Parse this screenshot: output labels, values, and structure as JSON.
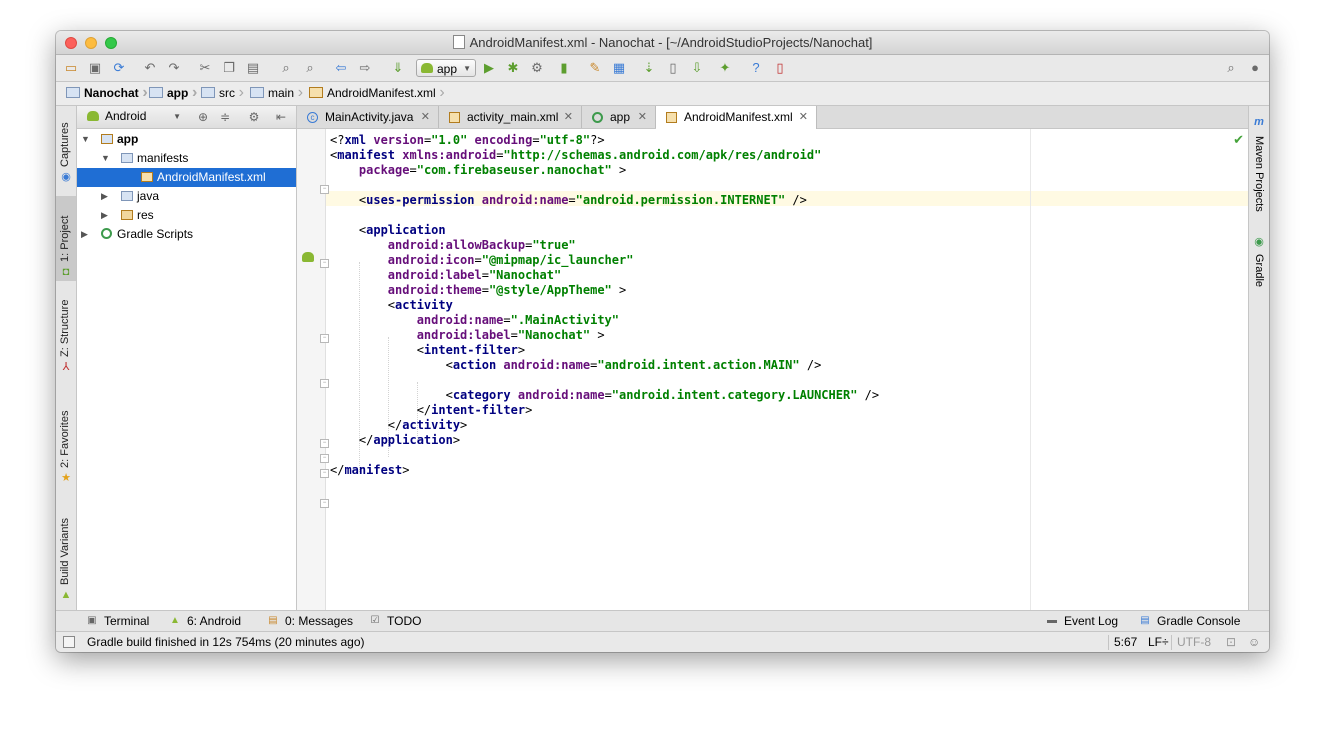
{
  "window": {
    "title": "AndroidManifest.xml - Nanochat - [~/AndroidStudioProjects/Nanochat]"
  },
  "toolbar": {
    "run_config": "app"
  },
  "breadcrumbs": [
    "Nanochat",
    "app",
    "src",
    "main",
    "AndroidManifest.xml"
  ],
  "left_tools": [
    {
      "label": "Captures"
    },
    {
      "label": "1: Project"
    },
    {
      "label": "Z: Structure"
    },
    {
      "label": "2: Favorites"
    },
    {
      "label": "Build Variants"
    }
  ],
  "right_tools": [
    {
      "label": "Maven Projects"
    },
    {
      "label": "Gradle"
    }
  ],
  "project": {
    "view": "Android",
    "tree": [
      {
        "label": "app",
        "icon": "app-folder-icon"
      },
      {
        "label": "manifests",
        "icon": "folder-icon"
      },
      {
        "label": "AndroidManifest.xml",
        "icon": "xml-file-icon",
        "selected": true
      },
      {
        "label": "java",
        "icon": "folder-icon"
      },
      {
        "label": "res",
        "icon": "res-folder-icon"
      },
      {
        "label": "Gradle Scripts",
        "icon": "gradle-icon"
      }
    ]
  },
  "tabs": [
    {
      "label": "MainActivity.java",
      "icon": "java-class-icon"
    },
    {
      "label": "activity_main.xml",
      "icon": "xml-file-icon"
    },
    {
      "label": "app",
      "icon": "gradle-icon"
    },
    {
      "label": "AndroidManifest.xml",
      "icon": "xml-file-icon",
      "active": true
    }
  ],
  "code_lines": [
    [
      [
        "pl",
        "<?"
      ],
      [
        "tg",
        "xml "
      ],
      [
        "an",
        "version"
      ],
      [
        "pl",
        "="
      ],
      [
        "av",
        "\"1.0\""
      ],
      [
        "pl",
        " "
      ],
      [
        "an",
        "encoding"
      ],
      [
        "pl",
        "="
      ],
      [
        "av",
        "\"utf-8\""
      ],
      [
        "pl",
        "?>"
      ]
    ],
    [
      [
        "pl",
        "<"
      ],
      [
        "tg",
        "manifest "
      ],
      [
        "an",
        "xmlns:android"
      ],
      [
        "pl",
        "="
      ],
      [
        "av",
        "\"http://schemas.android.com/apk/res/android\""
      ]
    ],
    [
      [
        "pl",
        "    "
      ],
      [
        "an",
        "package"
      ],
      [
        "pl",
        "="
      ],
      [
        "av",
        "\"com.firebaseuser.nanochat\""
      ],
      [
        "pl",
        " >"
      ]
    ],
    [],
    [
      [
        "pl",
        "    <"
      ],
      [
        "tg",
        "uses-permission "
      ],
      [
        "an",
        "android:name"
      ],
      [
        "pl",
        "="
      ],
      [
        "av",
        "\"android.permission.INTERNET\""
      ],
      [
        "pl",
        " />"
      ]
    ],
    [],
    [
      [
        "pl",
        "    <"
      ],
      [
        "tg",
        "application"
      ]
    ],
    [
      [
        "pl",
        "        "
      ],
      [
        "an",
        "android:allowBackup"
      ],
      [
        "pl",
        "="
      ],
      [
        "av",
        "\"true\""
      ]
    ],
    [
      [
        "pl",
        "        "
      ],
      [
        "an",
        "android:icon"
      ],
      [
        "pl",
        "="
      ],
      [
        "av",
        "\"@mipmap/ic_launcher\""
      ]
    ],
    [
      [
        "pl",
        "        "
      ],
      [
        "an",
        "android:label"
      ],
      [
        "pl",
        "="
      ],
      [
        "av",
        "\"Nanochat\""
      ]
    ],
    [
      [
        "pl",
        "        "
      ],
      [
        "an",
        "android:theme"
      ],
      [
        "pl",
        "="
      ],
      [
        "av",
        "\"@style/AppTheme\""
      ],
      [
        "pl",
        " >"
      ]
    ],
    [
      [
        "pl",
        "        <"
      ],
      [
        "tg",
        "activity"
      ]
    ],
    [
      [
        "pl",
        "            "
      ],
      [
        "an",
        "android:name"
      ],
      [
        "pl",
        "="
      ],
      [
        "av",
        "\".MainActivity\""
      ]
    ],
    [
      [
        "pl",
        "            "
      ],
      [
        "an",
        "android:label"
      ],
      [
        "pl",
        "="
      ],
      [
        "av",
        "\"Nanochat\""
      ],
      [
        "pl",
        " >"
      ]
    ],
    [
      [
        "pl",
        "            <"
      ],
      [
        "tg",
        "intent-filter"
      ],
      [
        "pl",
        ">"
      ]
    ],
    [
      [
        "pl",
        "                <"
      ],
      [
        "tg",
        "action "
      ],
      [
        "an",
        "android:name"
      ],
      [
        "pl",
        "="
      ],
      [
        "av",
        "\"android.intent.action.MAIN\""
      ],
      [
        "pl",
        " />"
      ]
    ],
    [],
    [
      [
        "pl",
        "                <"
      ],
      [
        "tg",
        "category "
      ],
      [
        "an",
        "android:name"
      ],
      [
        "pl",
        "="
      ],
      [
        "av",
        "\"android.intent.category.LAUNCHER\""
      ],
      [
        "pl",
        " />"
      ]
    ],
    [
      [
        "pl",
        "            </"
      ],
      [
        "tg",
        "intent-filter"
      ],
      [
        "pl",
        ">"
      ]
    ],
    [
      [
        "pl",
        "        </"
      ],
      [
        "tg",
        "activity"
      ],
      [
        "pl",
        ">"
      ]
    ],
    [
      [
        "pl",
        "    </"
      ],
      [
        "tg",
        "application"
      ],
      [
        "pl",
        ">"
      ]
    ],
    [],
    [
      [
        "pl",
        "</"
      ],
      [
        "tg",
        "manifest"
      ],
      [
        "pl",
        ">"
      ]
    ]
  ],
  "bottom_tools": [
    {
      "label": "Terminal",
      "icon": "terminal-icon"
    },
    {
      "label": "6: Android",
      "icon": "android-icon"
    },
    {
      "label": "0: Messages",
      "icon": "messages-icon"
    },
    {
      "label": "TODO",
      "icon": "todo-icon"
    }
  ],
  "bottom_right_tools": [
    {
      "label": "Event Log",
      "icon": "event-log-icon"
    },
    {
      "label": "Gradle Console",
      "icon": "gradle-console-icon"
    }
  ],
  "status": {
    "message": "Gradle build finished in 12s 754ms (20 minutes ago)",
    "position": "5:67",
    "line_sep": "LF÷",
    "encoding": "UTF-8"
  },
  "colors": {
    "tag": "#000080",
    "attr_name": "#660e7a",
    "attr_value": "#008000",
    "selection": "#1f6ed4",
    "caret_line": "#fffae3"
  }
}
